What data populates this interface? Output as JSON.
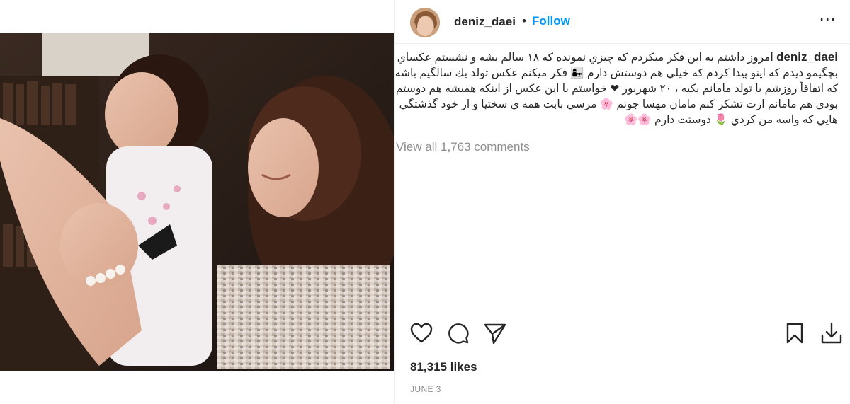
{
  "post": {
    "username": "deniz_daei",
    "separator": "•",
    "follow_label": "Follow",
    "more_icon": "⋯",
    "caption_username": "deniz_daei",
    "caption_text": "امروز داشتم به این فکر میکردم که چیزي نمونده که ۱۸ سالم بشه و نشستم عکساي بچگیمو دیدم که اینو پیدا کردم که خیلي هم دوستش دارم 👩‍👧 فکر میکنم عکس تولد یك سالگیم باشه که اتفاقاً روزشم با تولد مامانم یکیه ، ۲۰ شهریور ❤ خواستم با این عکس از اینکه همیشه هم دوستم بودي هم مامانم ازت تشکر کنم مامان مهسا جونم 🌸 مرسي بابت همه ي سختیا و از خود گذشتگي هایي که واسه من کردي 🌷 دوستت دارم 🌸🌸",
    "view_all_comments": "View all 1,763 comments",
    "likes": "81,315 likes",
    "date": "JUNE 3"
  },
  "icons": {
    "like": "heart-icon",
    "comment": "comment-icon",
    "share": "send-icon",
    "save": "bookmark-icon",
    "download": "download-icon"
  },
  "colors": {
    "follow": "#0095f6",
    "text": "#262626",
    "muted": "#8e8e8e"
  }
}
